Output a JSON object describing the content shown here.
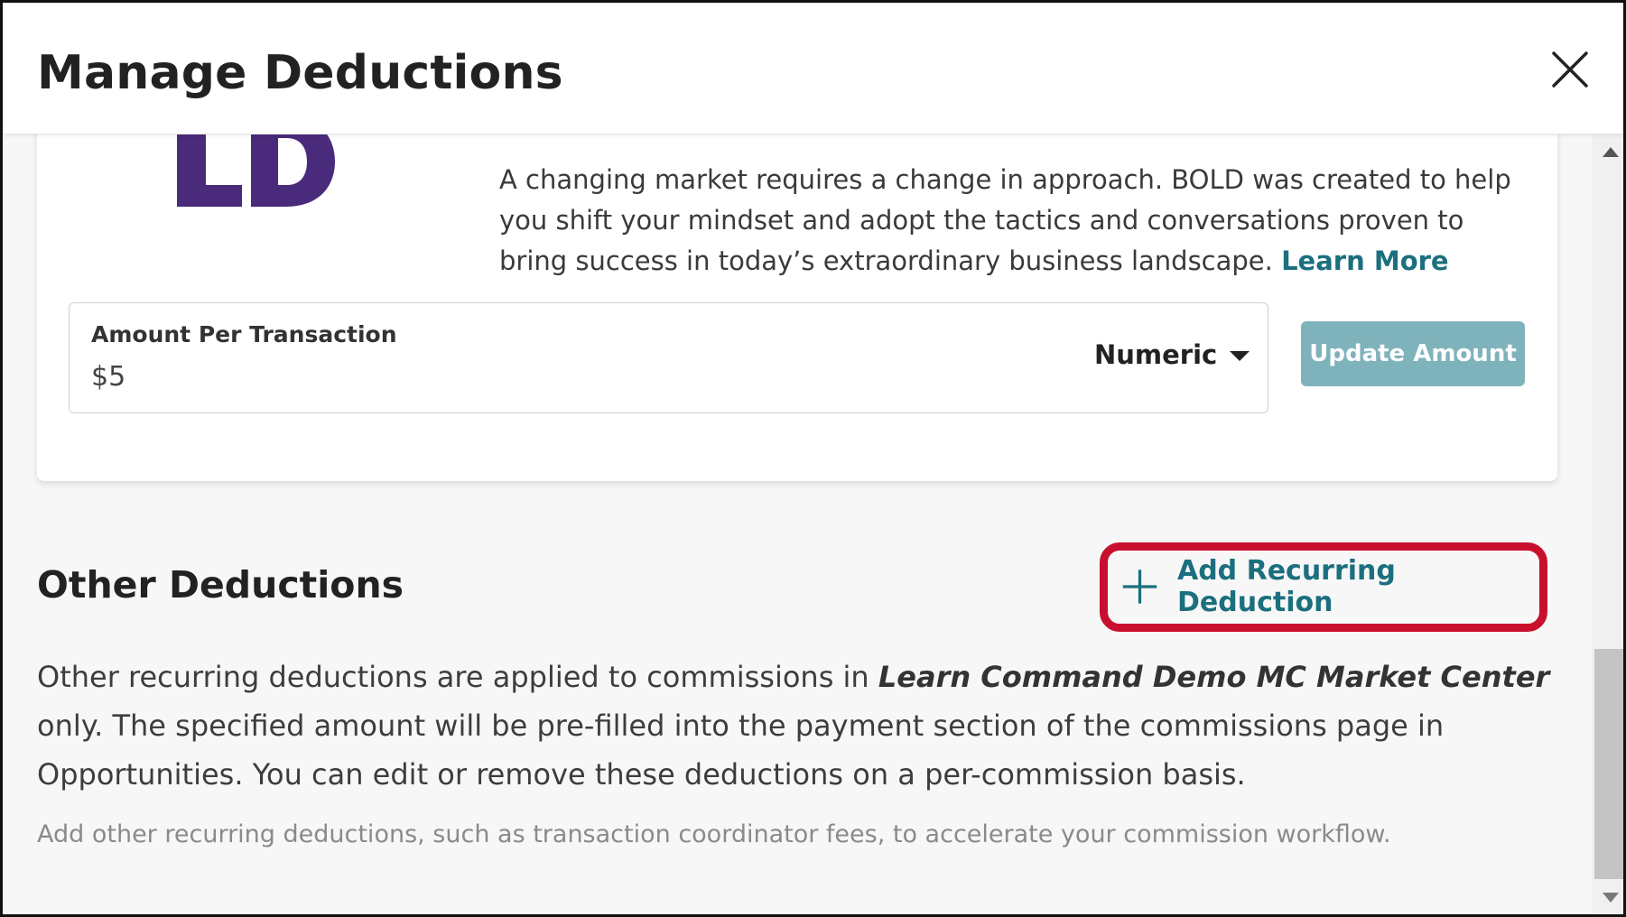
{
  "header": {
    "title": "Manage Deductions"
  },
  "card": {
    "logo_text": "LD",
    "description": "A changing market requires a change in approach. BOLD was created to help you shift your mindset and adopt the tactics and conversations proven to bring success in today’s extraordinary business landscape.",
    "learn_more_label": "Learn More",
    "amount_field": {
      "label": "Amount Per Transaction",
      "value": "$5"
    },
    "type_select": {
      "selected": "Numeric"
    },
    "update_button_label": "Update Amount"
  },
  "other_deductions": {
    "title": "Other Deductions",
    "add_button_label": "Add Recurring Deduction",
    "description_prefix": "Other recurring deductions are applied to commissions in ",
    "market_center": "Learn Command Demo MC Market Center",
    "description_suffix": " only. The specified amount will be pre-filled into the payment section of the commissions page in Opportunities. You can edit or remove these deductions on a per-commission basis.",
    "hint": "Add other recurring deductions, such as transaction coordinator fees, to accelerate your commission workflow."
  },
  "colors": {
    "accent_teal": "#1b6f7e",
    "button_disabled_teal": "#7fb3bc",
    "logo_purple": "#4a2a7a",
    "highlight_red": "#c8102e"
  },
  "icons": {
    "close": "close-icon",
    "plus": "plus-icon",
    "caret": "caret-down-icon"
  }
}
